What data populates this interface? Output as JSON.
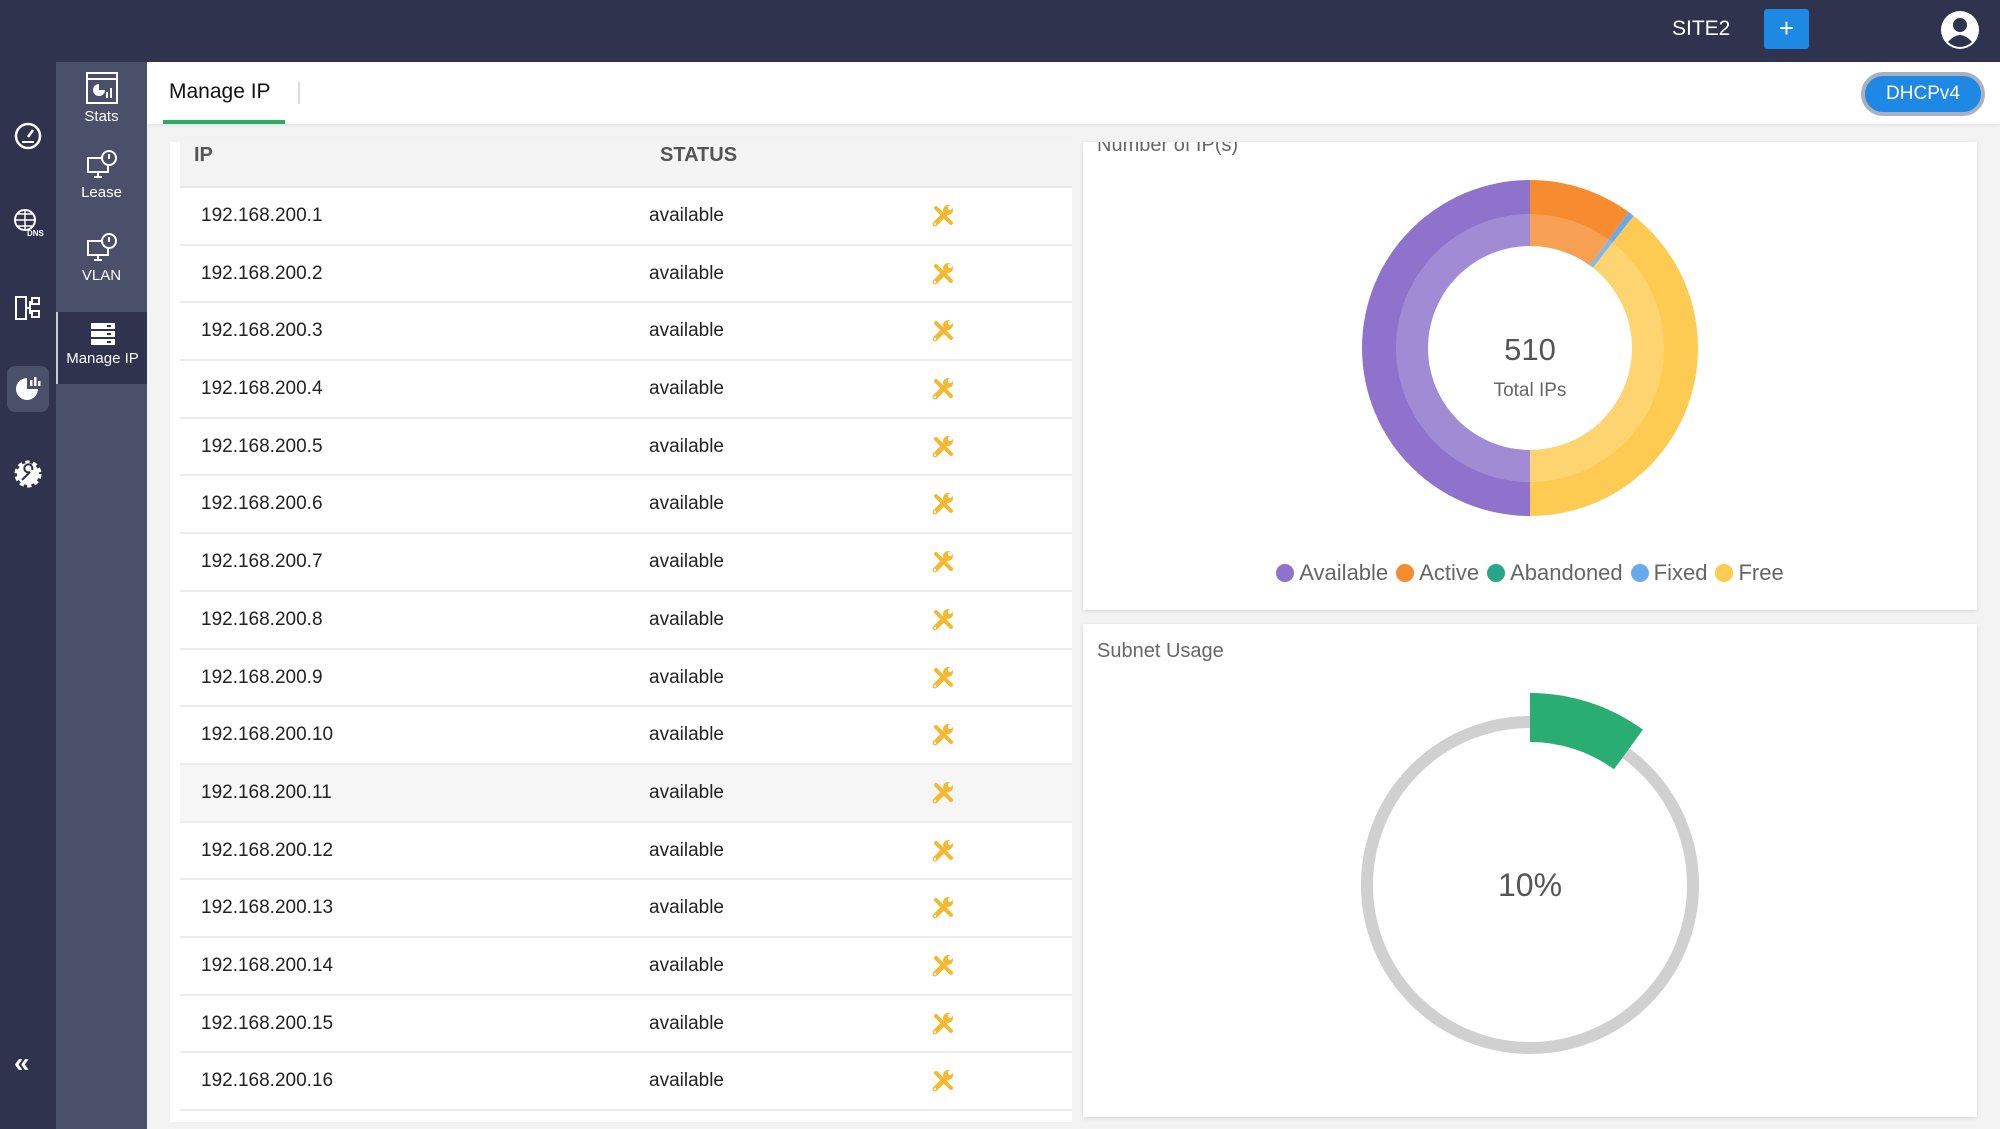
{
  "topbar": {
    "site": "SITE2",
    "add_label": "+"
  },
  "rail": {
    "items": [
      {
        "name": "dashboard",
        "icon": "speedometer-icon"
      },
      {
        "name": "dns",
        "icon": "globe-dns-icon"
      },
      {
        "name": "network",
        "icon": "server-network-icon"
      },
      {
        "name": "dhcp",
        "icon": "pie-chart-icon",
        "active": true
      },
      {
        "name": "settings",
        "icon": "gear-wrench-icon"
      }
    ],
    "collapse_label": "«"
  },
  "subnav": {
    "items": [
      {
        "label": "Stats",
        "icon": "stats-window-icon"
      },
      {
        "label": "Lease",
        "icon": "monitor-clock-icon"
      },
      {
        "label": "VLAN",
        "icon": "monitor-clock-icon"
      },
      {
        "label": "Manage IP",
        "icon": "server-stack-icon",
        "active": true
      }
    ]
  },
  "content": {
    "tab": "Manage IP",
    "protocol_button": "DHCPv4"
  },
  "table": {
    "columns": [
      "IP",
      "STATUS"
    ],
    "rows": [
      {
        "ip": "192.168.200.1",
        "status": "available"
      },
      {
        "ip": "192.168.200.2",
        "status": "available"
      },
      {
        "ip": "192.168.200.3",
        "status": "available"
      },
      {
        "ip": "192.168.200.4",
        "status": "available"
      },
      {
        "ip": "192.168.200.5",
        "status": "available"
      },
      {
        "ip": "192.168.200.6",
        "status": "available"
      },
      {
        "ip": "192.168.200.7",
        "status": "available"
      },
      {
        "ip": "192.168.200.8",
        "status": "available"
      },
      {
        "ip": "192.168.200.9",
        "status": "available"
      },
      {
        "ip": "192.168.200.10",
        "status": "available"
      },
      {
        "ip": "192.168.200.11",
        "status": "available"
      },
      {
        "ip": "192.168.200.12",
        "status": "available"
      },
      {
        "ip": "192.168.200.13",
        "status": "available"
      },
      {
        "ip": "192.168.200.14",
        "status": "available"
      },
      {
        "ip": "192.168.200.15",
        "status": "available"
      },
      {
        "ip": "192.168.200.16",
        "status": "available"
      }
    ]
  },
  "chart_data": [
    {
      "type": "pie",
      "title": "Number of IP(s)",
      "center_value": "510",
      "center_label": "Total IPs",
      "categories": [
        "Available",
        "Active",
        "Abandoned",
        "Fixed",
        "Free"
      ],
      "values": [
        255,
        51,
        0,
        3,
        201
      ],
      "colors": [
        "#8e72cc",
        "#f68c2f",
        "#2aa58a",
        "#6aa9ea",
        "#fecb52"
      ],
      "legend": "bottom"
    },
    {
      "type": "gauge",
      "title": "Subnet Usage",
      "value_percent": 10,
      "label": "10%",
      "colors": {
        "fill": "#2aad72",
        "track": "#d0d0d0"
      }
    }
  ]
}
